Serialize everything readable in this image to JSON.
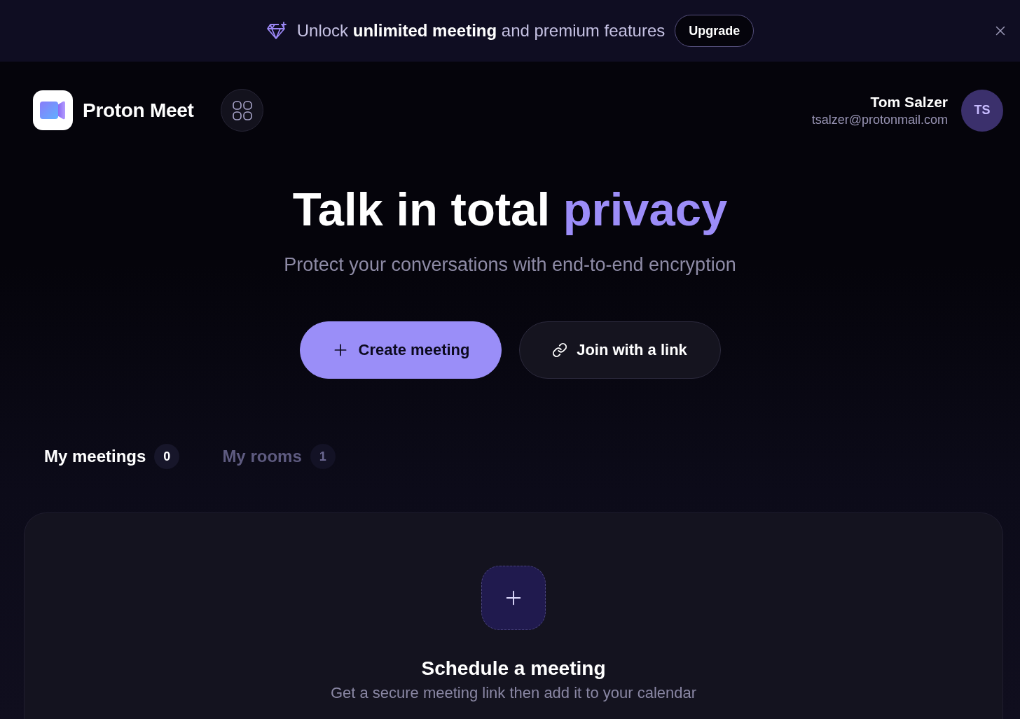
{
  "banner": {
    "message": "Unlock **unlimited meeting** and premium features",
    "button": "Upgrade"
  },
  "header": {
    "brand": "Proton Meet",
    "user": {
      "name": "Tom Salzer",
      "email": "tsalzer@protonmail.com",
      "initials": "TS"
    }
  },
  "hero": {
    "title": "Talk in total",
    "highlight": "privacy",
    "subtitle": "Protect your conversations with end-to-end encryption",
    "actions": [
      {
        "kind": "primary",
        "label": "Create meeting"
      },
      {
        "kind": "secondary",
        "label": "Join with a link"
      }
    ]
  },
  "tabs": [
    {
      "label": "My meetings",
      "count": "0",
      "selected": true
    },
    {
      "label": "My rooms",
      "count": "1",
      "selected": false
    }
  ],
  "empty_state": {
    "title": "Schedule a meeting",
    "text": "Get a secure meeting link then add it to your calendar"
  }
}
